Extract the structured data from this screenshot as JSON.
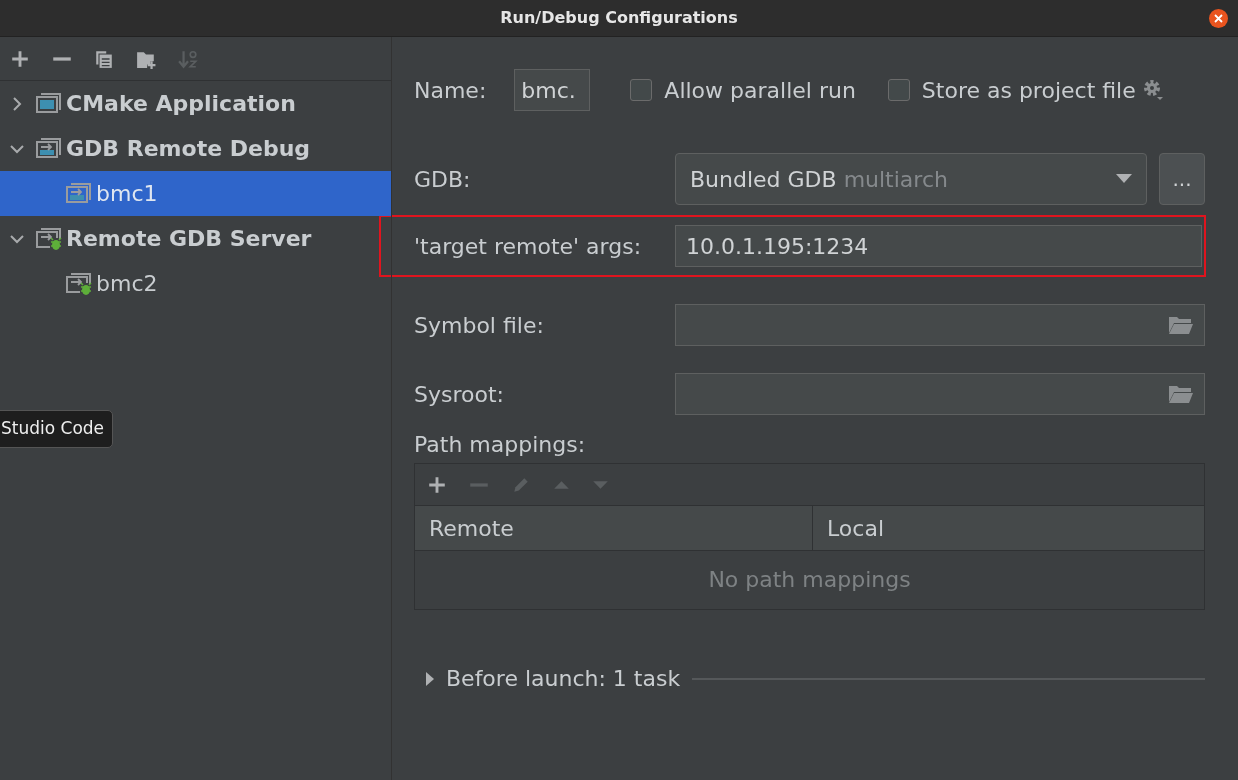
{
  "window": {
    "title": "Run/Debug Configurations"
  },
  "toolbar": [
    {
      "kind": "add",
      "disabled": false
    },
    {
      "kind": "remove",
      "disabled": false
    },
    {
      "kind": "copy",
      "disabled": false
    },
    {
      "kind": "folder",
      "disabled": false
    },
    {
      "kind": "sort",
      "disabled": true
    }
  ],
  "tree": [
    {
      "label": "CMake Application",
      "kind": "cmake",
      "expanded": false,
      "selected": false
    },
    {
      "label": "GDB Remote Debug",
      "kind": "gdb-remote",
      "expanded": true,
      "selected": false,
      "children": [
        {
          "label": "bmc1",
          "kind": "gdb-remote",
          "selected": true
        }
      ]
    },
    {
      "label": "Remote GDB Server",
      "kind": "remote-server",
      "expanded": true,
      "selected": false,
      "children": [
        {
          "label": "bmc2",
          "kind": "remote-server",
          "selected": false
        }
      ]
    }
  ],
  "tooltip": "Studio Code",
  "name": {
    "label": "Name:",
    "value": "bmc."
  },
  "options": [
    {
      "label": "Allow parallel run",
      "checked": false
    },
    {
      "label": "Store as project file",
      "checked": false
    }
  ],
  "form": [
    {
      "label": "GDB:",
      "kind": "combo",
      "value": "Bundled GDB",
      "hint": "multiarch",
      "button": "...",
      "highlighted": false
    },
    {
      "label": "'target remote' args:",
      "kind": "text",
      "value": "10.0.1.195:1234",
      "highlighted": true
    },
    {
      "label": "Symbol file:",
      "kind": "file",
      "highlighted": false
    },
    {
      "label": "Sysroot:",
      "kind": "file",
      "highlighted": false
    }
  ],
  "path_mappings": {
    "label": "Path mappings:",
    "tools": [
      {
        "kind": "add",
        "disabled": false
      },
      {
        "kind": "remove",
        "disabled": true
      },
      {
        "kind": "edit",
        "disabled": true
      },
      {
        "kind": "up",
        "disabled": true
      },
      {
        "kind": "down",
        "disabled": true
      }
    ],
    "columns": [
      "Remote",
      "Local"
    ],
    "empty_text": "No path mappings"
  },
  "before_launch": {
    "label": "Before launch: 1 task",
    "expanded": false
  }
}
